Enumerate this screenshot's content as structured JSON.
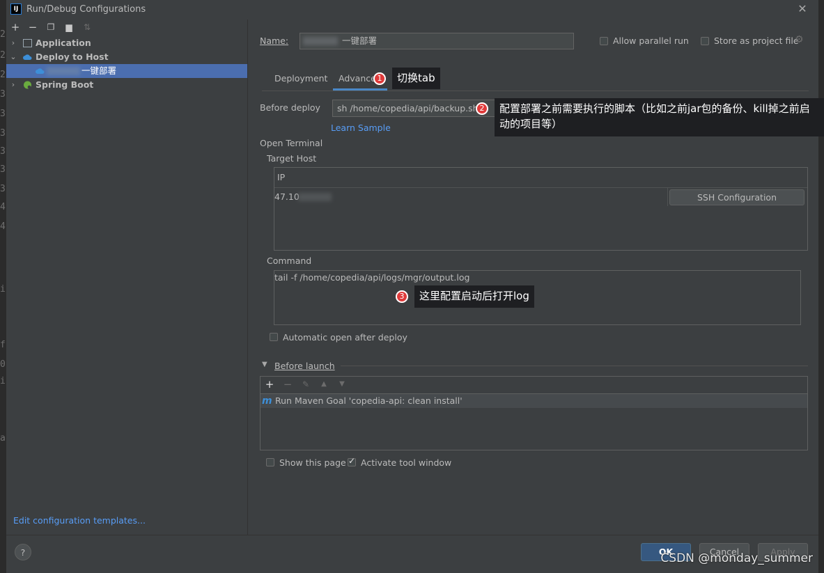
{
  "window": {
    "title": "Run/Debug Configurations",
    "app_icon": "IJ"
  },
  "edge_left_chars": [
    "2",
    "2",
    "2",
    "3",
    "3",
    "3",
    "3",
    "3",
    "3",
    "4",
    "4",
    "4",
    "4",
    "4"
  ],
  "edge_left_chars2": [
    "ic",
    "",
    "f",
    "0(",
    "i",
    "",
    "a"
  ],
  "tree": [
    {
      "label": "Application",
      "expanded": false,
      "icon": "application-icon"
    },
    {
      "label": "Deploy to Host",
      "expanded": true,
      "icon": "cloud-icon"
    },
    {
      "label": "一键部署",
      "selected": true,
      "icon": "cloud-icon"
    },
    {
      "label": "Spring Boot",
      "expanded": false,
      "icon": "spring-icon"
    }
  ],
  "left_link": "Edit configuration templates...",
  "name_label": "Name:",
  "name_value": "一键部署",
  "allow_parallel": "Allow parallel run",
  "store_project": "Store as project file",
  "tabs": [
    "Deployment",
    "Advanced"
  ],
  "before_deploy_label": "Before deploy",
  "before_deploy_value": "sh /home/copedia/api/backup.sh",
  "learn_sample": "Learn Sample",
  "open_terminal": "Open Terminal",
  "target_host": "Target Host",
  "ip_header": "IP",
  "ip_value": "47.10",
  "ssh_button": "SSH Configuration",
  "command_label": "Command",
  "command_value": "tail -f /home/copedia/api/logs/mgr/output.log",
  "auto_open": "Automatic open after deploy",
  "before_launch": "Before launch",
  "maven_row": "Run Maven Goal 'copedia-api: clean install'",
  "show_page": "Show this page",
  "activate_window": "Activate tool window",
  "buttons": {
    "help": "?",
    "ok": "OK",
    "cancel": "Cancel",
    "apply": "Apply"
  },
  "annotations": [
    {
      "num": "1",
      "text": "切换tab"
    },
    {
      "num": "2",
      "text": "配置部署之前需要执行的脚本（比如之前jar包的备份、kill掉之前启动的项目等）"
    },
    {
      "num": "3",
      "text": "这里配置启动后打开log"
    }
  ],
  "watermark": "CSDN @monday_summer",
  "colors": {
    "accent": "#4b6eaf",
    "link": "#589df6",
    "badge": "#e03a3a"
  }
}
